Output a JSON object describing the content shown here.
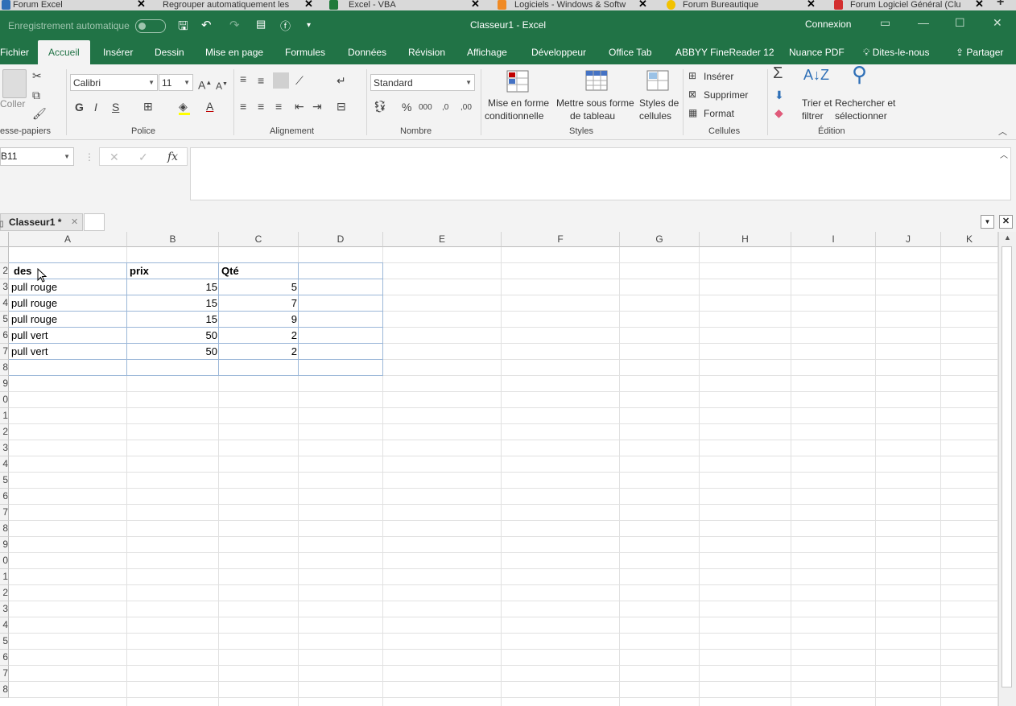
{
  "browser_tabs": [
    {
      "label": "Forum Excel",
      "close": "✕",
      "color": "#2e6fb7"
    },
    {
      "label": "Regrouper automatiquement les",
      "close": "✕",
      "color": "#2e6fb7"
    },
    {
      "label": "Excel - VBA",
      "close": "✕",
      "color": "#1f7a3a"
    },
    {
      "label": "Logiciels - Windows & Softw",
      "close": "✕",
      "color": "#f08a24"
    },
    {
      "label": "Forum Bureautique",
      "close": "✕",
      "color": "#f2c200"
    },
    {
      "label": "Forum Logiciel Général (Clu",
      "close": "✕",
      "color": "#d32f2f"
    }
  ],
  "new_tab": "+",
  "titlebar": {
    "autosave": "Enregistrement automatique",
    "document": "Classeur1  -  Excel",
    "connexion": "Connexion"
  },
  "menu_tabs": [
    "Fichier",
    "Accueil",
    "Insérer",
    "Dessin",
    "Mise en page",
    "Formules",
    "Données",
    "Révision",
    "Affichage",
    "Développeur",
    "Office Tab",
    "ABBYY FineReader 12",
    "Nuance PDF",
    "Dites-le-nous",
    "Partager"
  ],
  "ribbon": {
    "clipboard": {
      "paste": "Coller",
      "label": "esse-papiers"
    },
    "font": {
      "name": "Calibri",
      "size": "11",
      "bold": "G",
      "italic": "I",
      "underline": "S",
      "label": "Police"
    },
    "alignment": {
      "label": "Alignement"
    },
    "number": {
      "format": "Standard",
      "label": "Nombre"
    },
    "styles": {
      "cond1": "Mise en forme",
      "cond2": "conditionnelle",
      "table1": "Mettre sous forme",
      "table2": "de tableau",
      "cell1": "Styles de",
      "cell2": "cellules",
      "label": "Styles"
    },
    "cells": {
      "insert": "Insérer",
      "delete": "Supprimer",
      "format": "Format",
      "label": "Cellules"
    },
    "editing": {
      "sort1": "Trier et",
      "sort2": "filtrer",
      "find1": "Rechercher et",
      "find2": "sélectionner",
      "label": "Édition"
    }
  },
  "formula_bar": {
    "namebox": "B11",
    "formula": ""
  },
  "sheet_tab": {
    "label": "Classeur1 *",
    "close": "✕"
  },
  "columns": [
    "A",
    "B",
    "C",
    "D",
    "E",
    "F",
    "G",
    "H",
    "I",
    "J",
    "K"
  ],
  "row_numbers": [
    "",
    "2",
    "3",
    "4",
    "5",
    "6",
    "7",
    "8",
    "9",
    "0",
    "1",
    "2",
    "3",
    "4",
    "5",
    "6",
    "7",
    "8",
    "9",
    "0",
    "1",
    "2",
    "3",
    "4",
    "5",
    "6",
    "7",
    "8"
  ],
  "table": {
    "headers": [
      "des",
      "prix",
      "Qté"
    ],
    "rows": [
      [
        "pull rouge",
        "15",
        "5"
      ],
      [
        "pull rouge",
        "15",
        "7"
      ],
      [
        "pull rouge",
        "15",
        "9"
      ],
      [
        "pull vert",
        "50",
        "2"
      ],
      [
        "pull vert",
        "50",
        "2"
      ]
    ]
  },
  "colors": {
    "excel_green": "#217346",
    "ribbon_bg": "#f3f3f3",
    "table_border": "#9bb7d8"
  }
}
